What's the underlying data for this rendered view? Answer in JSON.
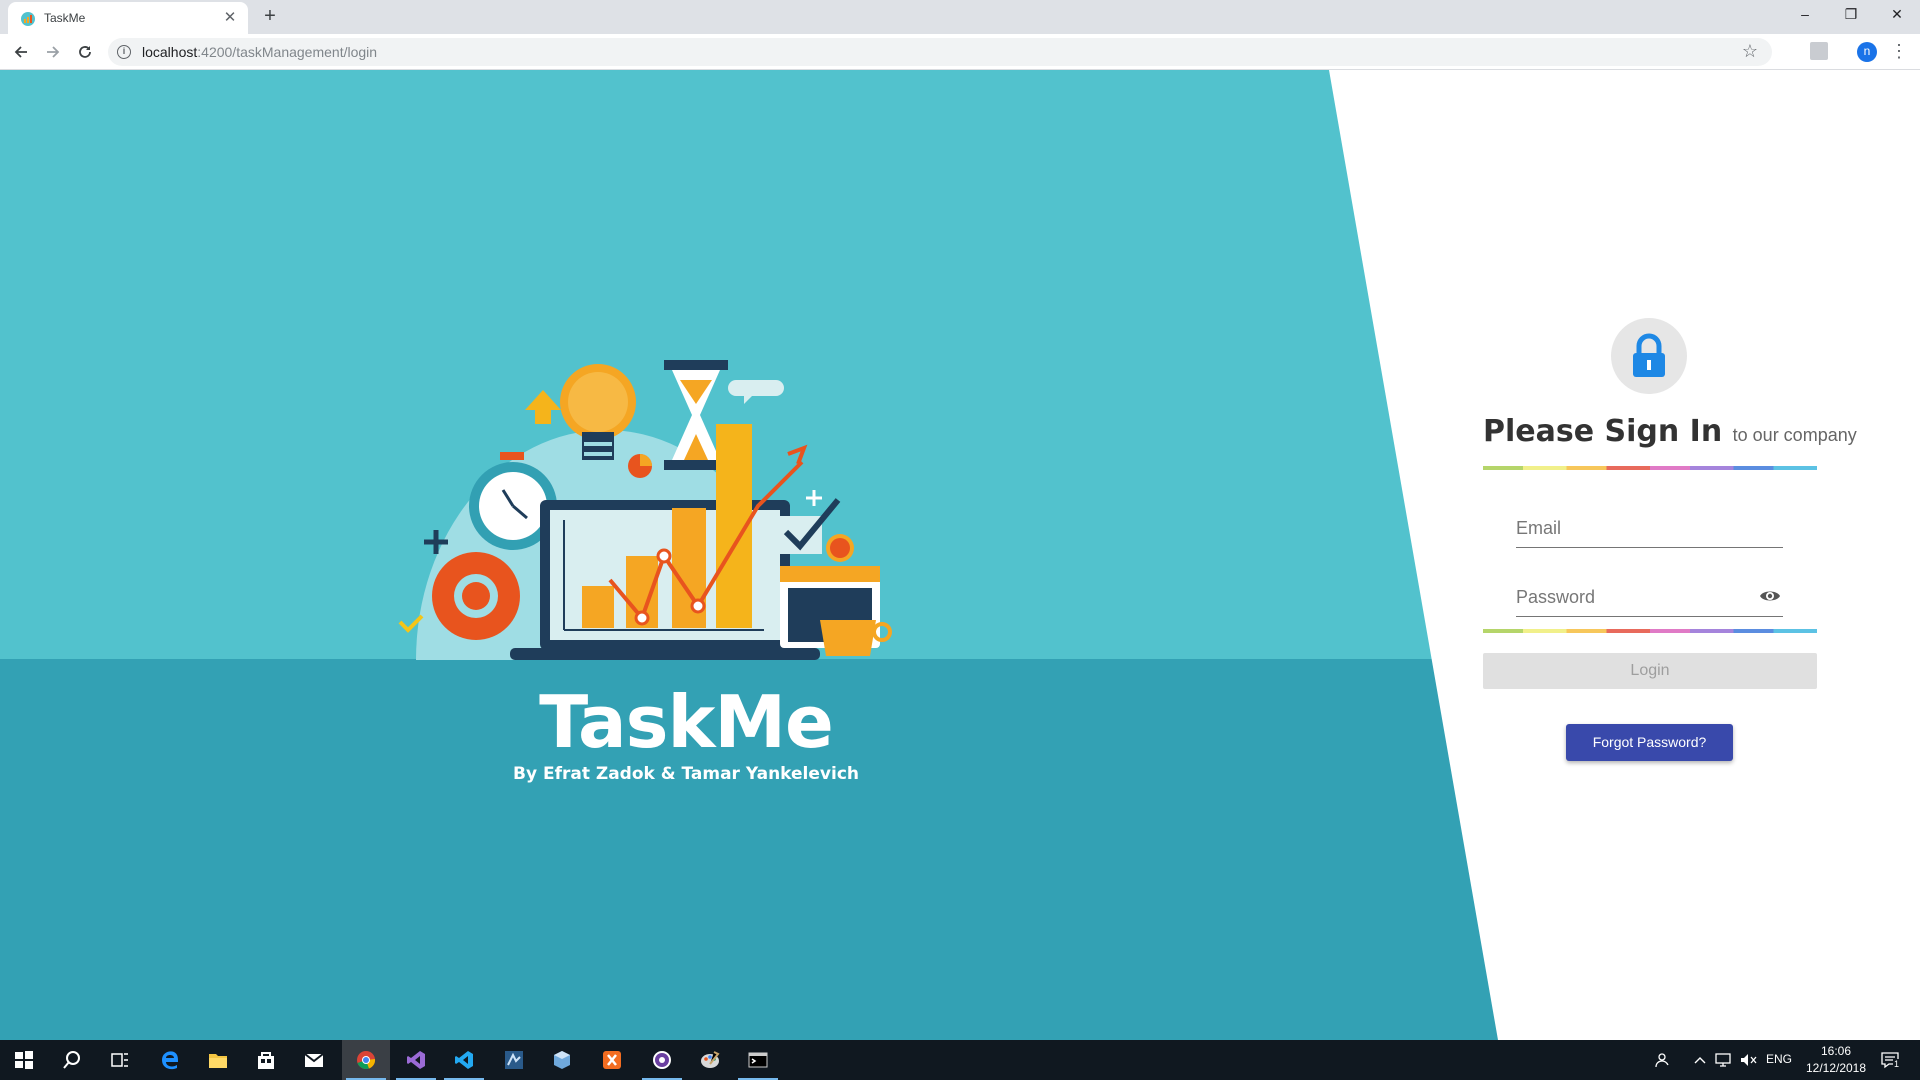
{
  "browser": {
    "tab_title": "TaskMe",
    "tab_close": "✕",
    "new_tab": "+",
    "url_host": "localhost",
    "url_rest": ":4200/taskManagement/login",
    "profile_initial": "n",
    "window_controls": {
      "minimize": "–",
      "restore": "❐",
      "close": "✕"
    }
  },
  "hero": {
    "title": "TaskMe",
    "subtitle": "By Efrat Zadok & Tamar Yankelevich"
  },
  "login": {
    "heading": "Please Sign In",
    "heading_suffix": "to our company",
    "email_placeholder": "Email",
    "password_placeholder": "Password",
    "login_label": "Login",
    "forgot_label": "Forgot Password?"
  },
  "taskbar": {
    "language": "ENG",
    "time": "16:06",
    "date": "12/12/2018",
    "notification_count": "1"
  },
  "colors": {
    "hero_top": "#52c2cd",
    "hero_bottom": "#33a1b4",
    "forgot_button": "#3949ab",
    "lock_icon": "#1e88e5"
  }
}
